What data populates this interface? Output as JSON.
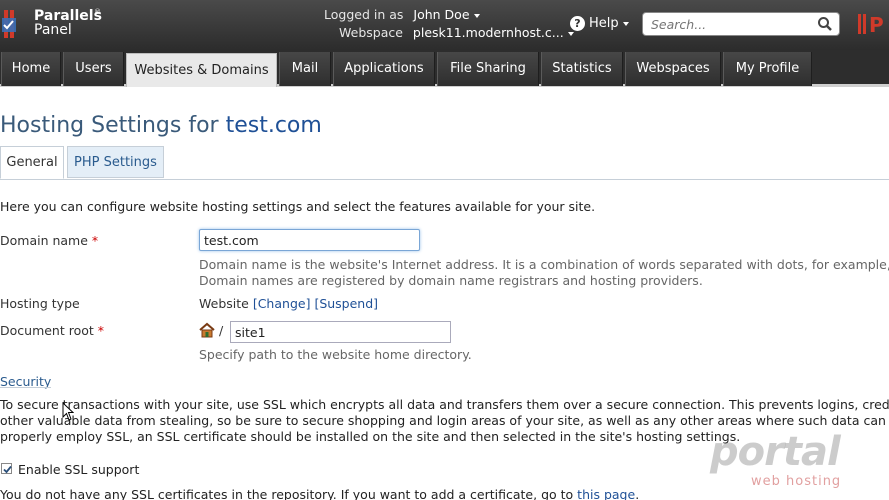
{
  "header": {
    "logo_line1": "Parallels",
    "logo_reg": "®",
    "logo_line2": "Panel",
    "logged_in_label": "Logged in as",
    "user_name": "John Doe",
    "webspace_label": "Webspace",
    "webspace_value": "plesk11.modernhost.c...",
    "help_label": "Help",
    "search_placeholder": "Search..."
  },
  "nav": {
    "items": [
      {
        "label": "Home"
      },
      {
        "label": "Users"
      },
      {
        "label": "Websites & Domains"
      },
      {
        "label": "Mail"
      },
      {
        "label": "Applications"
      },
      {
        "label": "File Sharing"
      },
      {
        "label": "Statistics"
      },
      {
        "label": "Webspaces"
      },
      {
        "label": "My Profile"
      }
    ],
    "active": "Websites & Domains"
  },
  "page": {
    "title_prefix": "Hosting Settings for",
    "title_domain": "test.com",
    "tabs": [
      {
        "label": "General"
      },
      {
        "label": "PHP Settings"
      }
    ],
    "intro": "Here you can configure website hosting settings and select the features available for your site."
  },
  "form": {
    "domain_name": {
      "label": "Domain name",
      "required_mark": "*",
      "value": "test.com",
      "hint_line1": "Domain name is the website's Internet address. It is a combination of words separated with dots, for example, mycompany.com.",
      "hint_line2": "Domain names are registered by domain name registrars and hosting providers."
    },
    "hosting_type": {
      "label": "Hosting type",
      "value": "Website",
      "change_link": "[Change]",
      "suspend_link": "[Suspend]"
    },
    "document_root": {
      "label": "Document root",
      "required_mark": "*",
      "separator": "/",
      "value": "site1",
      "hint": "Specify path to the website home directory."
    }
  },
  "security": {
    "title": "Security",
    "paragraph_line1": "To secure transactions with your site, use SSL which encrypts all data and transfers them over a secure connection. This prevents logins, credit card numbers and",
    "paragraph_line2": "other valuable data from stealing, so be sure to secure shopping and login areas of your site, as well as any other areas where such data can be transferred. To",
    "paragraph_line3": "properly employ SSL, an SSL certificate should be installed on the site and then selected in the site's hosting settings.",
    "ssl_label": "Enable SSL support",
    "ssl_checked": true,
    "footnote_prefix": "You do not have any SSL certificates in the repository. If you want to add a certificate, go to",
    "footnote_link": "this page",
    "footnote_suffix": "."
  },
  "watermark": {
    "top": "portal",
    "bottom": "web hosting"
  },
  "colors": {
    "link": "#1f5096",
    "header_bg": "#2c2c2c",
    "accent_red": "#d03a2a"
  }
}
